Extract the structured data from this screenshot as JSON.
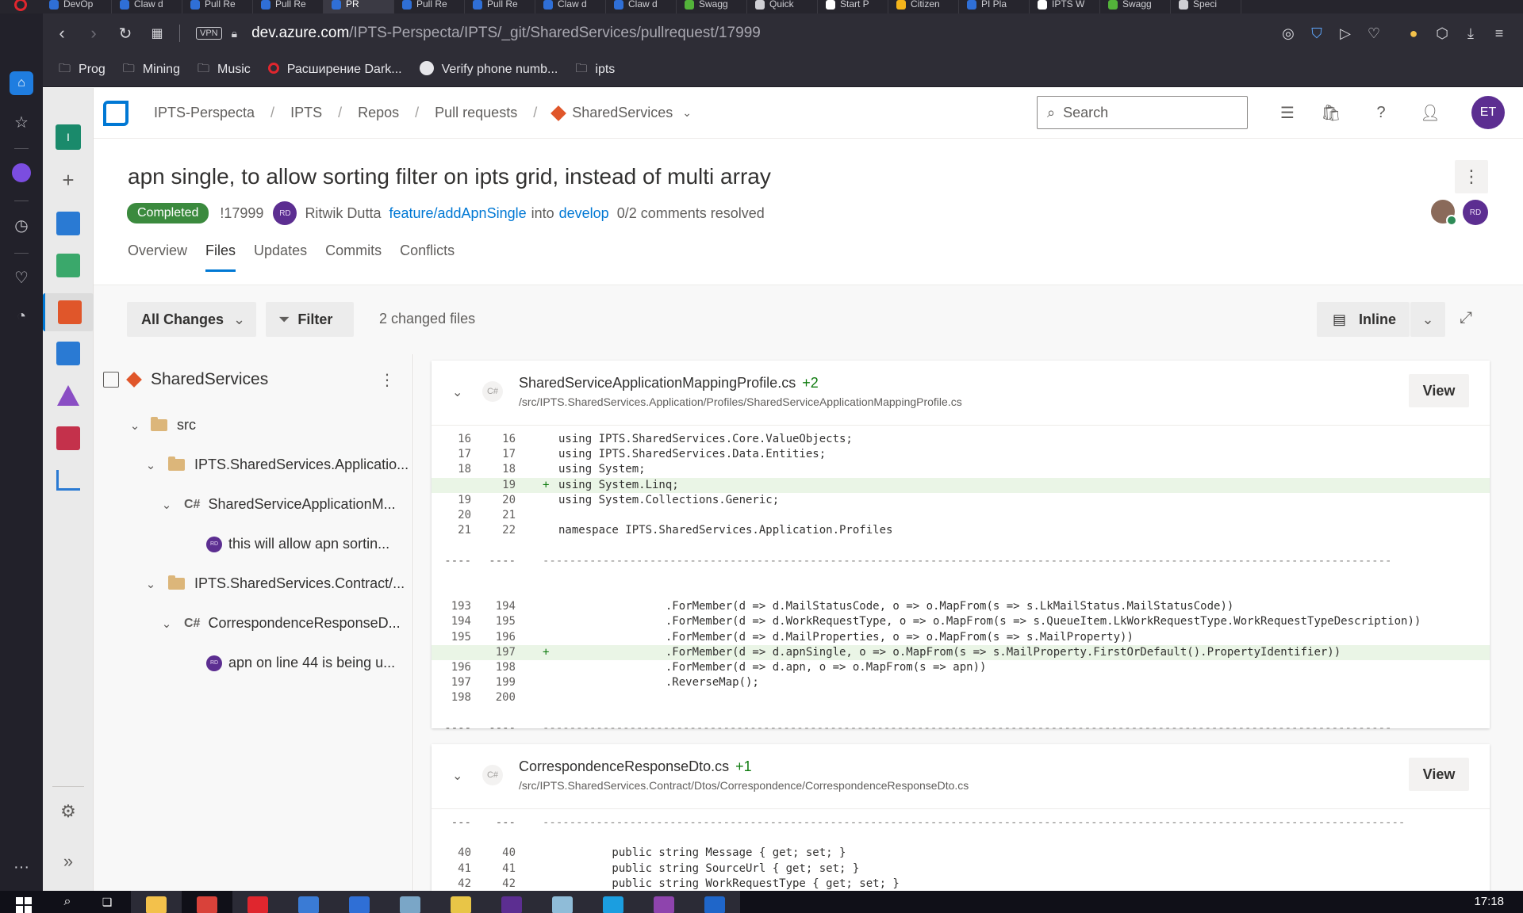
{
  "browser": {
    "tabs": [
      {
        "label": "DevOp",
        "color": "#2f6fd6"
      },
      {
        "label": "Claw d",
        "color": "#2f6fd6"
      },
      {
        "label": "Pull Re",
        "color": "#2f6fd6"
      },
      {
        "label": "Pull Re",
        "color": "#2f6fd6"
      },
      {
        "label": "PR",
        "color": "#2f6fd6",
        "active": true
      },
      {
        "label": "Pull Re",
        "color": "#2f6fd6"
      },
      {
        "label": "Pull Re",
        "color": "#2f6fd6"
      },
      {
        "label": "Claw d",
        "color": "#2f6fd6"
      },
      {
        "label": "Claw d",
        "color": "#2f6fd6"
      },
      {
        "label": "Swagg",
        "color": "#53b33a"
      },
      {
        "label": "Quick",
        "color": "#cfcfd4"
      },
      {
        "label": "Start P",
        "color": "#ffffff"
      },
      {
        "label": "Citizen",
        "color": "#f3b41b"
      },
      {
        "label": "PI Pla",
        "color": "#2f6fd6"
      },
      {
        "label": "IPTS W",
        "color": "#ffffff"
      },
      {
        "label": "Swagg",
        "color": "#53b33a"
      },
      {
        "label": "Speci",
        "color": "#cfcfd4"
      }
    ],
    "vpn_label": "VPN",
    "url_domain": "dev.azure.com",
    "url_path": "/IPTS-Perspecta/IPTS/_git/SharedServices/pullrequest/17999",
    "bookmarks": [
      {
        "label": "Prog",
        "icon": "folder-icon"
      },
      {
        "label": "Mining",
        "icon": "folder-icon"
      },
      {
        "label": "Music",
        "icon": "folder-icon"
      },
      {
        "label": "Расширение Dark...",
        "icon": "opera-extension-icon"
      },
      {
        "label": "Verify phone numb...",
        "icon": "globe-icon"
      },
      {
        "label": "ipts",
        "icon": "folder-icon"
      }
    ]
  },
  "breadcrumb": {
    "org": "IPTS-Perspecta",
    "project": "IPTS",
    "repos": "Repos",
    "pull_requests": "Pull requests",
    "repo": "SharedServices"
  },
  "search": {
    "placeholder": "Search"
  },
  "user": {
    "initials": "ET"
  },
  "pr": {
    "title": "apn single, to allow sorting filter on ipts grid, instead of multi array",
    "status": "Completed",
    "id": "!17999",
    "author_initials": "RD",
    "author": "Ritwik Dutta",
    "source_branch": "feature/addApnSingle",
    "into": "into",
    "target_branch": "develop",
    "comments": "0/2 comments resolved",
    "reviewer_initials": "RD"
  },
  "tabs": [
    {
      "label": "Overview"
    },
    {
      "label": "Files",
      "active": true
    },
    {
      "label": "Updates"
    },
    {
      "label": "Commits"
    },
    {
      "label": "Conflicts"
    }
  ],
  "toolbar": {
    "all_changes": "All Changes",
    "filter": "Filter",
    "changed_files": "2 changed files",
    "view_mode": "Inline"
  },
  "tree": {
    "root": "SharedServices",
    "src": "src",
    "folder1": "IPTS.SharedServices.Applicatio...",
    "file1": "SharedServiceApplicationM...",
    "comment1": "this will allow apn sortin...",
    "folder2": "IPTS.SharedServices.Contract/...",
    "file2": "CorrespondenceResponseD...",
    "comment2": "apn on line 44 is being u...",
    "cs_tag": "C#",
    "comment_initials": "RD"
  },
  "files": [
    {
      "name": "SharedServiceApplicationMappingProfile.cs",
      "delta": "+2",
      "path": "/src/IPTS.SharedServices.Application/Profiles/SharedServiceApplicationMappingProfile.cs",
      "lang": "C#",
      "view_label": "View",
      "lines": [
        {
          "o": "16",
          "n": "16",
          "m": "",
          "t": "using IPTS.SharedServices.Core.ValueObjects;"
        },
        {
          "o": "17",
          "n": "17",
          "m": "",
          "t": "using IPTS.SharedServices.Data.Entities;"
        },
        {
          "o": "18",
          "n": "18",
          "m": "",
          "t": "using System;"
        },
        {
          "o": "",
          "n": "19",
          "m": "+",
          "t": "using System.Linq;",
          "add": true
        },
        {
          "o": "19",
          "n": "20",
          "m": "",
          "t": "using System.Collections.Generic;"
        },
        {
          "o": "20",
          "n": "21",
          "m": "",
          "t": ""
        },
        {
          "o": "21",
          "n": "22",
          "m": "",
          "t": "namespace IPTS.SharedServices.Application.Profiles"
        },
        {
          "o": "",
          "n": "",
          "m": "",
          "t": ""
        },
        {
          "o": "----",
          "n": "----",
          "m": "",
          "t": "-------------------------------------------------------------------------------------------------------------------------------",
          "sep": true
        },
        {
          "o": "",
          "n": "",
          "m": "",
          "t": ""
        },
        {
          "o": "",
          "n": "",
          "m": "",
          "t": ""
        },
        {
          "o": "193",
          "n": "194",
          "m": "",
          "t": "                .ForMember(d => d.MailStatusCode, o => o.MapFrom(s => s.LkMailStatus.MailStatusCode))"
        },
        {
          "o": "194",
          "n": "195",
          "m": "",
          "t": "                .ForMember(d => d.WorkRequestType, o => o.MapFrom(s => s.QueueItem.LkWorkRequestType.WorkRequestTypeDescription))"
        },
        {
          "o": "195",
          "n": "196",
          "m": "",
          "t": "                .ForMember(d => d.MailProperties, o => o.MapFrom(s => s.MailProperty))"
        },
        {
          "o": "",
          "n": "197",
          "m": "+",
          "t": "                .ForMember(d => d.apnSingle, o => o.MapFrom(s => s.MailProperty.FirstOrDefault().PropertyIdentifier))",
          "add": true
        },
        {
          "o": "196",
          "n": "198",
          "m": "",
          "t": "                .ForMember(d => d.apn, o => o.MapFrom(s => apn))"
        },
        {
          "o": "197",
          "n": "199",
          "m": "",
          "t": "                .ReverseMap();"
        },
        {
          "o": "198",
          "n": "200",
          "m": "",
          "t": ""
        },
        {
          "o": "",
          "n": "",
          "m": "",
          "t": ""
        },
        {
          "o": "----",
          "n": "----",
          "m": "",
          "t": "-------------------------------------------------------------------------------------------------------------------------------",
          "sep": true
        }
      ]
    },
    {
      "name": "CorrespondenceResponseDto.cs",
      "delta": "+1",
      "path": "/src/IPTS.SharedServices.Contract/Dtos/Correspondence/CorrespondenceResponseDto.cs",
      "lang": "C#",
      "view_label": "View",
      "lines": [
        {
          "o": "---",
          "n": "---",
          "m": "",
          "t": "---------------------------------------------------------------------------------------------------------------------------------",
          "sep": true
        },
        {
          "o": "",
          "n": "",
          "m": "",
          "t": ""
        },
        {
          "o": "40",
          "n": "40",
          "m": "",
          "t": "        public string Message { get; set; }"
        },
        {
          "o": "41",
          "n": "41",
          "m": "",
          "t": "        public string SourceUrl { get; set; }"
        },
        {
          "o": "42",
          "n": "42",
          "m": "",
          "t": "        public string WorkRequestType { get; set; }"
        }
      ]
    }
  ],
  "taskbar": {
    "clock": "17:18",
    "apps": [
      {
        "name": "file-explorer-icon",
        "color": "#f3c14b",
        "active": true
      },
      {
        "name": "chrome-icon",
        "color": "#d9423a"
      },
      {
        "name": "opera-icon",
        "color": "#e0262e",
        "active": true
      },
      {
        "name": "app-icon",
        "color": "#3a7bd5",
        "active": true
      },
      {
        "name": "outlook-icon",
        "color": "#2f6fd6",
        "active": true
      },
      {
        "name": "notepad-icon",
        "color": "#7aa6c7",
        "active": true
      },
      {
        "name": "sticky-icon",
        "color": "#e8c547",
        "active": true
      },
      {
        "name": "terminal-icon",
        "color": "#5c2e91",
        "active": true
      },
      {
        "name": "pencil-icon",
        "color": "#8fbcd8",
        "active": true
      },
      {
        "name": "skype-icon",
        "color": "#1b9ee0",
        "active": true
      },
      {
        "name": "visual-studio-icon",
        "color": "#8e44ad",
        "active": true
      },
      {
        "name": "app2-icon",
        "color": "#1f66c9",
        "active": true
      }
    ]
  }
}
